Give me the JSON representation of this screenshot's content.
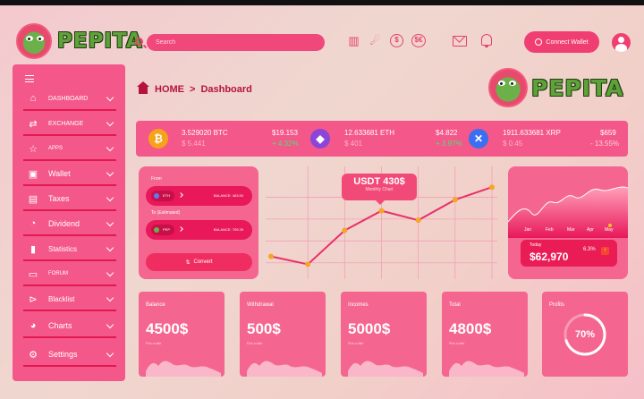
{
  "header": {
    "brand": "PEPITA",
    "search_placeholder": "Search",
    "connect_wallet": "Connect Wallet"
  },
  "sidebar": {
    "items": [
      {
        "label": "DASHBOARD",
        "icon": "home-icon"
      },
      {
        "label": "EXCHANGE",
        "icon": "exchange-icon"
      },
      {
        "label": "APPS",
        "icon": "star-icon"
      },
      {
        "label": "Wallet",
        "icon": "wallet-icon"
      },
      {
        "label": "Taxes",
        "icon": "taxes-icon"
      },
      {
        "label": "Dividend",
        "icon": "pie-icon"
      },
      {
        "label": "Statistics",
        "icon": "bar-chart-icon"
      },
      {
        "label": "FORUM",
        "icon": "chat-icon"
      },
      {
        "label": "Blacklist",
        "icon": "blacklist-icon"
      },
      {
        "label": "Charts",
        "icon": "chart-icon"
      },
      {
        "label": "Settings",
        "icon": "gear-icon"
      }
    ]
  },
  "breadcrumb": {
    "home": "HOME",
    "sep": ">",
    "current": "Dashboard"
  },
  "ticker": [
    {
      "amount": "3.529020 BTC",
      "sub": "$ 5.441",
      "price": "$19.153",
      "change": "+ 4.32%",
      "dir": "up",
      "coin_color": "#f7a21b",
      "icon": "bitcoin-icon"
    },
    {
      "amount": "12.633681 ETH",
      "sub": "$ 401",
      "price": "$4.822",
      "change": "+ 3.97%",
      "dir": "up",
      "coin_color": "#8b45d8",
      "icon": "ethereum-icon"
    },
    {
      "amount": "1911.633681 XRP",
      "sub": "$ 0.45",
      "price": "$659",
      "change": "- 13.55%",
      "dir": "down",
      "coin_color": "#3a6ff2",
      "icon": "xrp-icon"
    }
  ],
  "converter": {
    "from_label": "From",
    "to_label": "To (Estimated)",
    "from_coin": "ETH",
    "to_coin": "PEP",
    "from_balance": "BALANCE: 463.50",
    "to_balance": "BALANCE: 709.39",
    "convert_label": "Convert"
  },
  "main_chart": {
    "badge_value": "USDT 430$",
    "badge_sub": "Monthly Chart"
  },
  "chart_data": {
    "type": "line",
    "values": [
      22,
      12,
      55,
      80,
      68,
      94,
      110
    ],
    "ylim": [
      0,
      125
    ]
  },
  "area_card": {
    "months": [
      "Jan",
      "Feb",
      "Mar",
      "Apr",
      "May"
    ],
    "today_label": "Today",
    "today_value": "$62,970",
    "today_pct": "6.3%"
  },
  "stats": [
    {
      "title": "Balance",
      "value": "4500$",
      "sub": "Pick a date"
    },
    {
      "title": "Withdrawal",
      "value": "500$",
      "sub": "Pick a date"
    },
    {
      "title": "Incomes",
      "value": "5000$",
      "sub": "Pick a date"
    },
    {
      "title": "Total",
      "value": "4800$",
      "sub": "Pick a date"
    }
  ],
  "profits": {
    "title": "Profits",
    "value": "70%",
    "percent": 70
  }
}
